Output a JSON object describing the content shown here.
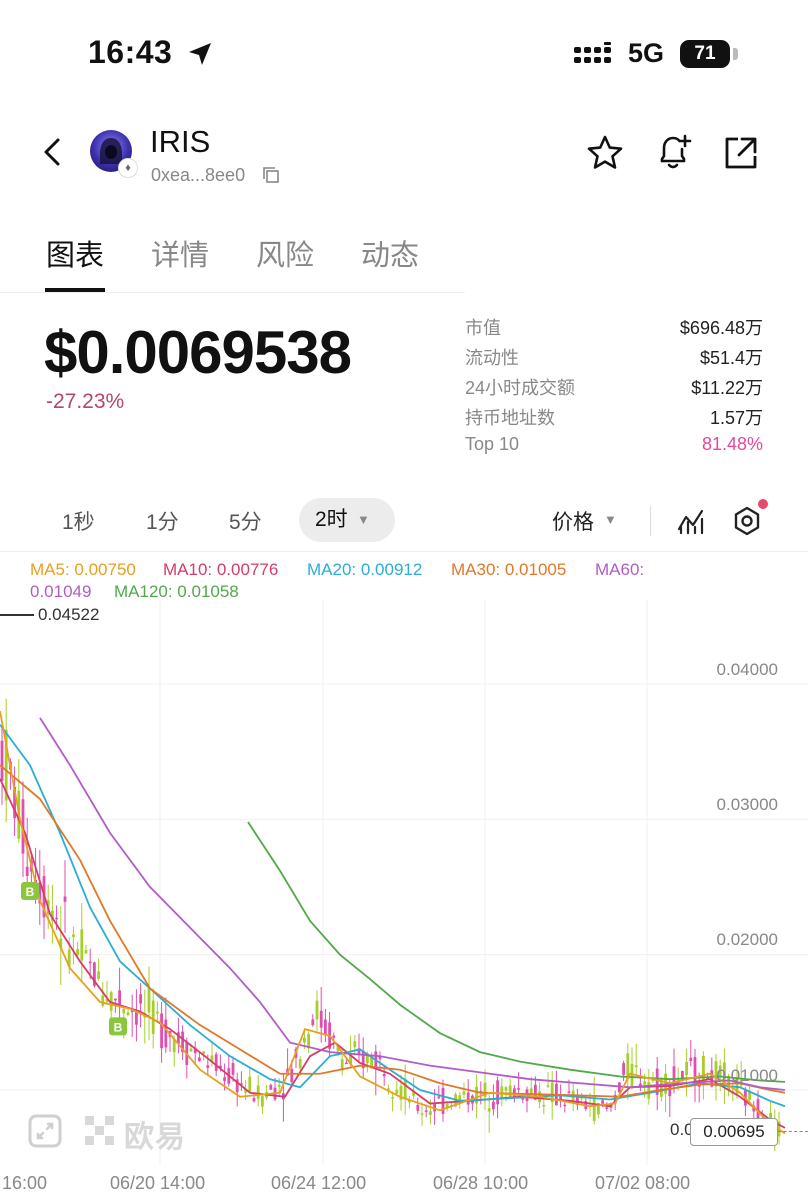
{
  "status_bar": {
    "time": "16:43",
    "network": "5G",
    "battery": "71"
  },
  "header": {
    "name": "IRIS",
    "address": "0xea...8ee0"
  },
  "tabs": [
    {
      "label": "图表"
    },
    {
      "label": "详情"
    },
    {
      "label": "风险"
    },
    {
      "label": "动态"
    }
  ],
  "price": {
    "value": "$0.0069538",
    "change": "-27.23%"
  },
  "stats": [
    {
      "label": "市值",
      "value": "$696.48万"
    },
    {
      "label": "流动性",
      "value": "$51.4万"
    },
    {
      "label": "24小时成交额",
      "value": "$11.22万"
    },
    {
      "label": "持币地址数",
      "value": "1.57万"
    },
    {
      "label": "Top 10",
      "value": "81.48%"
    }
  ],
  "intervals": [
    {
      "label": "1秒"
    },
    {
      "label": "1分"
    },
    {
      "label": "5分"
    },
    {
      "label": "2时"
    }
  ],
  "price_mode": "价格",
  "ma_legend": {
    "ma5": "MA5: 0.00750",
    "ma10": "MA10: 0.00776",
    "ma20": "MA20: 0.00912",
    "ma30": "MA30: 0.01005",
    "ma60": "MA60:",
    "ma60_value": "0.01049",
    "ma120": "MA120: 0.01058"
  },
  "chart_data": {
    "type": "candlestick",
    "y_ticks": [
      "0.04000",
      "0.03000",
      "0.02000",
      "0.01000"
    ],
    "x_ticks": [
      "16:00",
      "06/20 14:00",
      "06/24 12:00",
      "06/28 10:00",
      "07/02 08:00"
    ],
    "high_marker": "0.04522",
    "current_price": "0.00695",
    "current_price_partial": "0.0",
    "buy_markers": [
      "B",
      "B"
    ],
    "series_colors": {
      "up": "#a7cf2a",
      "down": "#e04fb0",
      "MA5": "#e8a020",
      "MA10": "#d63c6a",
      "MA20": "#2aaed4",
      "MA30": "#e07828",
      "MA60": "#b25cc6",
      "MA120": "#52a84a"
    }
  },
  "watermark": "欧易",
  "colors": {
    "negative": "#b5476a",
    "highlight": "#e8489a",
    "accent_dot": "#e84a6a"
  }
}
